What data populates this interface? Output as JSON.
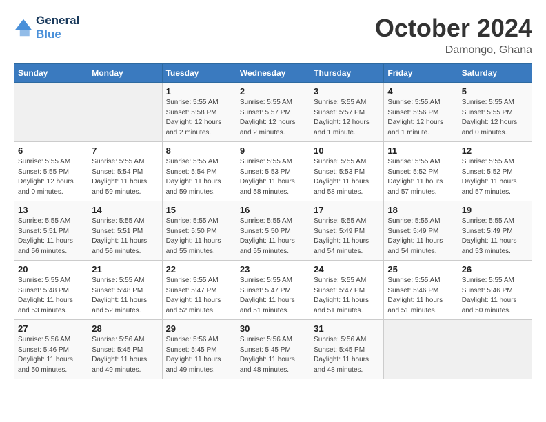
{
  "logo": {
    "line1": "General",
    "line2": "Blue"
  },
  "title": "October 2024",
  "location": "Damongo, Ghana",
  "days_of_week": [
    "Sunday",
    "Monday",
    "Tuesday",
    "Wednesday",
    "Thursday",
    "Friday",
    "Saturday"
  ],
  "weeks": [
    [
      {
        "day": "",
        "sunrise": "",
        "sunset": "",
        "daylight": ""
      },
      {
        "day": "",
        "sunrise": "",
        "sunset": "",
        "daylight": ""
      },
      {
        "day": "1",
        "sunrise": "Sunrise: 5:55 AM",
        "sunset": "Sunset: 5:58 PM",
        "daylight": "Daylight: 12 hours and 2 minutes."
      },
      {
        "day": "2",
        "sunrise": "Sunrise: 5:55 AM",
        "sunset": "Sunset: 5:57 PM",
        "daylight": "Daylight: 12 hours and 2 minutes."
      },
      {
        "day": "3",
        "sunrise": "Sunrise: 5:55 AM",
        "sunset": "Sunset: 5:57 PM",
        "daylight": "Daylight: 12 hours and 1 minute."
      },
      {
        "day": "4",
        "sunrise": "Sunrise: 5:55 AM",
        "sunset": "Sunset: 5:56 PM",
        "daylight": "Daylight: 12 hours and 1 minute."
      },
      {
        "day": "5",
        "sunrise": "Sunrise: 5:55 AM",
        "sunset": "Sunset: 5:55 PM",
        "daylight": "Daylight: 12 hours and 0 minutes."
      }
    ],
    [
      {
        "day": "6",
        "sunrise": "Sunrise: 5:55 AM",
        "sunset": "Sunset: 5:55 PM",
        "daylight": "Daylight: 12 hours and 0 minutes."
      },
      {
        "day": "7",
        "sunrise": "Sunrise: 5:55 AM",
        "sunset": "Sunset: 5:54 PM",
        "daylight": "Daylight: 11 hours and 59 minutes."
      },
      {
        "day": "8",
        "sunrise": "Sunrise: 5:55 AM",
        "sunset": "Sunset: 5:54 PM",
        "daylight": "Daylight: 11 hours and 59 minutes."
      },
      {
        "day": "9",
        "sunrise": "Sunrise: 5:55 AM",
        "sunset": "Sunset: 5:53 PM",
        "daylight": "Daylight: 11 hours and 58 minutes."
      },
      {
        "day": "10",
        "sunrise": "Sunrise: 5:55 AM",
        "sunset": "Sunset: 5:53 PM",
        "daylight": "Daylight: 11 hours and 58 minutes."
      },
      {
        "day": "11",
        "sunrise": "Sunrise: 5:55 AM",
        "sunset": "Sunset: 5:52 PM",
        "daylight": "Daylight: 11 hours and 57 minutes."
      },
      {
        "day": "12",
        "sunrise": "Sunrise: 5:55 AM",
        "sunset": "Sunset: 5:52 PM",
        "daylight": "Daylight: 11 hours and 57 minutes."
      }
    ],
    [
      {
        "day": "13",
        "sunrise": "Sunrise: 5:55 AM",
        "sunset": "Sunset: 5:51 PM",
        "daylight": "Daylight: 11 hours and 56 minutes."
      },
      {
        "day": "14",
        "sunrise": "Sunrise: 5:55 AM",
        "sunset": "Sunset: 5:51 PM",
        "daylight": "Daylight: 11 hours and 56 minutes."
      },
      {
        "day": "15",
        "sunrise": "Sunrise: 5:55 AM",
        "sunset": "Sunset: 5:50 PM",
        "daylight": "Daylight: 11 hours and 55 minutes."
      },
      {
        "day": "16",
        "sunrise": "Sunrise: 5:55 AM",
        "sunset": "Sunset: 5:50 PM",
        "daylight": "Daylight: 11 hours and 55 minutes."
      },
      {
        "day": "17",
        "sunrise": "Sunrise: 5:55 AM",
        "sunset": "Sunset: 5:49 PM",
        "daylight": "Daylight: 11 hours and 54 minutes."
      },
      {
        "day": "18",
        "sunrise": "Sunrise: 5:55 AM",
        "sunset": "Sunset: 5:49 PM",
        "daylight": "Daylight: 11 hours and 54 minutes."
      },
      {
        "day": "19",
        "sunrise": "Sunrise: 5:55 AM",
        "sunset": "Sunset: 5:49 PM",
        "daylight": "Daylight: 11 hours and 53 minutes."
      }
    ],
    [
      {
        "day": "20",
        "sunrise": "Sunrise: 5:55 AM",
        "sunset": "Sunset: 5:48 PM",
        "daylight": "Daylight: 11 hours and 53 minutes."
      },
      {
        "day": "21",
        "sunrise": "Sunrise: 5:55 AM",
        "sunset": "Sunset: 5:48 PM",
        "daylight": "Daylight: 11 hours and 52 minutes."
      },
      {
        "day": "22",
        "sunrise": "Sunrise: 5:55 AM",
        "sunset": "Sunset: 5:47 PM",
        "daylight": "Daylight: 11 hours and 52 minutes."
      },
      {
        "day": "23",
        "sunrise": "Sunrise: 5:55 AM",
        "sunset": "Sunset: 5:47 PM",
        "daylight": "Daylight: 11 hours and 51 minutes."
      },
      {
        "day": "24",
        "sunrise": "Sunrise: 5:55 AM",
        "sunset": "Sunset: 5:47 PM",
        "daylight": "Daylight: 11 hours and 51 minutes."
      },
      {
        "day": "25",
        "sunrise": "Sunrise: 5:55 AM",
        "sunset": "Sunset: 5:46 PM",
        "daylight": "Daylight: 11 hours and 51 minutes."
      },
      {
        "day": "26",
        "sunrise": "Sunrise: 5:55 AM",
        "sunset": "Sunset: 5:46 PM",
        "daylight": "Daylight: 11 hours and 50 minutes."
      }
    ],
    [
      {
        "day": "27",
        "sunrise": "Sunrise: 5:56 AM",
        "sunset": "Sunset: 5:46 PM",
        "daylight": "Daylight: 11 hours and 50 minutes."
      },
      {
        "day": "28",
        "sunrise": "Sunrise: 5:56 AM",
        "sunset": "Sunset: 5:45 PM",
        "daylight": "Daylight: 11 hours and 49 minutes."
      },
      {
        "day": "29",
        "sunrise": "Sunrise: 5:56 AM",
        "sunset": "Sunset: 5:45 PM",
        "daylight": "Daylight: 11 hours and 49 minutes."
      },
      {
        "day": "30",
        "sunrise": "Sunrise: 5:56 AM",
        "sunset": "Sunset: 5:45 PM",
        "daylight": "Daylight: 11 hours and 48 minutes."
      },
      {
        "day": "31",
        "sunrise": "Sunrise: 5:56 AM",
        "sunset": "Sunset: 5:45 PM",
        "daylight": "Daylight: 11 hours and 48 minutes."
      },
      {
        "day": "",
        "sunrise": "",
        "sunset": "",
        "daylight": ""
      },
      {
        "day": "",
        "sunrise": "",
        "sunset": "",
        "daylight": ""
      }
    ]
  ]
}
